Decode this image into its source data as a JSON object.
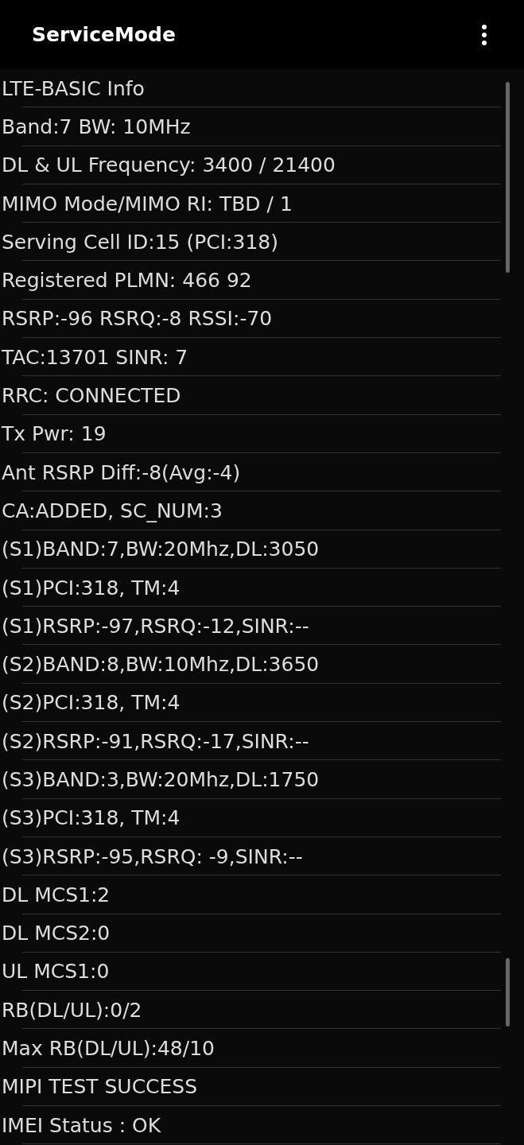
{
  "app_bar": {
    "title": "ServiceMode"
  },
  "lines": [
    "LTE-BASIC Info",
    "Band:7 BW: 10MHz",
    "DL & UL Frequency: 3400 / 21400",
    "MIMO Mode/MIMO RI: TBD / 1",
    "Serving Cell ID:15 (PCI:318)",
    "Registered PLMN: 466 92",
    "RSRP:-96 RSRQ:-8 RSSI:-70",
    "TAC:13701 SINR: 7",
    "RRC: CONNECTED",
    "Tx Pwr: 19",
    "Ant RSRP Diff:-8(Avg:-4)",
    "CA:ADDED, SC_NUM:3",
    "(S1)BAND:7,BW:20Mhz,DL:3050",
    "(S1)PCI:318, TM:4",
    "(S1)RSRP:-97,RSRQ:-12,SINR:--",
    "(S2)BAND:8,BW:10Mhz,DL:3650",
    "(S2)PCI:318, TM:4",
    "(S2)RSRP:-91,RSRQ:-17,SINR:--",
    "(S3)BAND:3,BW:20Mhz,DL:1750",
    "(S3)PCI:318, TM:4",
    "(S3)RSRP:-95,RSRQ: -9,SINR:--",
    "DL MCS1:2",
    "DL MCS2:0",
    "UL MCS1:0",
    "RB(DL/UL):0/2",
    "Max RB(DL/UL):48/10",
    "MIPI TEST SUCCESS",
    "IMEI Status : OK"
  ]
}
